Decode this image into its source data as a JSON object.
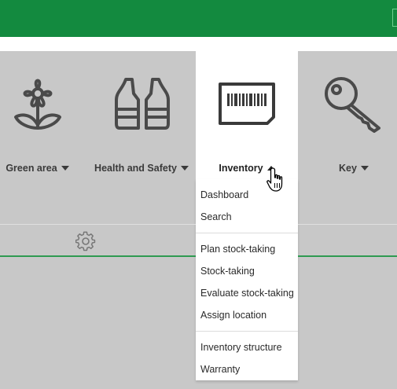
{
  "colors": {
    "brand_green": "#138a3f",
    "panel_gray": "#c8c8c8",
    "divider_green": "#2f9a51"
  },
  "nav": {
    "tiles": [
      {
        "label": "Green area",
        "icon": "flower-icon"
      },
      {
        "label": "Health and Safety",
        "icon": "safety-vest-icon"
      },
      {
        "label": "Inventory",
        "icon": "barcode-icon",
        "active": true
      },
      {
        "label": "Key",
        "icon": "key-icon"
      }
    ]
  },
  "dropdown": {
    "groups": [
      [
        "Dashboard",
        "Search"
      ],
      [
        "Plan stock-taking",
        "Stock-taking",
        "Evaluate stock-taking",
        "Assign location"
      ],
      [
        "Inventory structure",
        "Warranty"
      ]
    ]
  },
  "settings": {
    "icon": "gear-icon"
  }
}
